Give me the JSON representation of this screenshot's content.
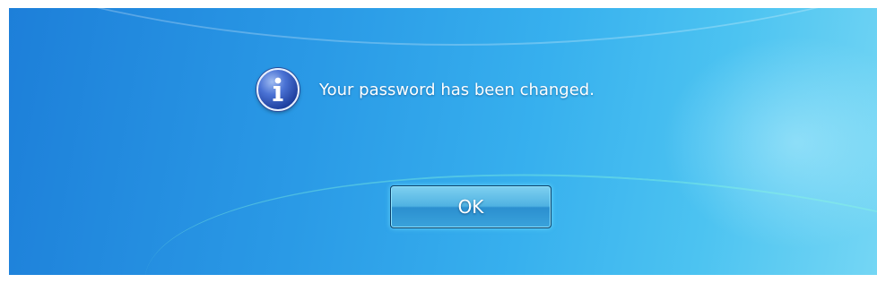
{
  "dialog": {
    "message": "Your password has been changed.",
    "icon": "info-icon",
    "ok_label": "OK"
  },
  "colors": {
    "background_left": "#1d7fd9",
    "background_right": "#74d6f4",
    "icon_blue": "#1e3f9e",
    "text": "#ffffff"
  }
}
